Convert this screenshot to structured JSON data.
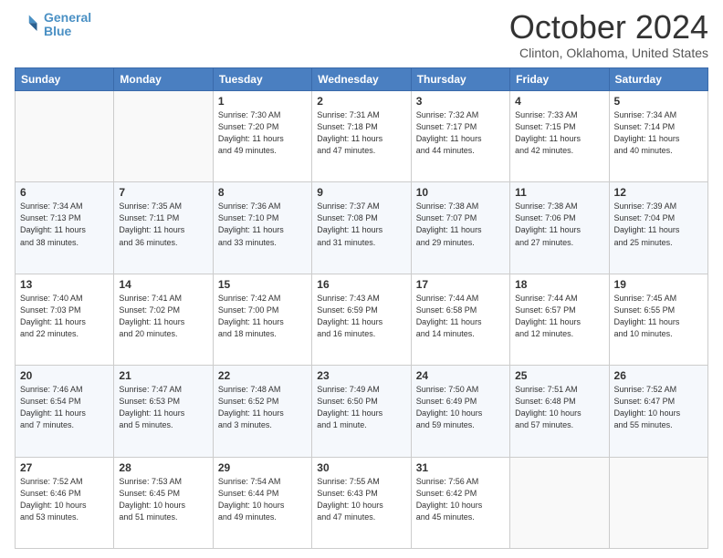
{
  "header": {
    "logo_line1": "General",
    "logo_line2": "Blue",
    "month": "October 2024",
    "location": "Clinton, Oklahoma, United States"
  },
  "weekdays": [
    "Sunday",
    "Monday",
    "Tuesday",
    "Wednesday",
    "Thursday",
    "Friday",
    "Saturday"
  ],
  "rows": [
    [
      {
        "day": "",
        "info": ""
      },
      {
        "day": "",
        "info": ""
      },
      {
        "day": "1",
        "info": "Sunrise: 7:30 AM\nSunset: 7:20 PM\nDaylight: 11 hours\nand 49 minutes."
      },
      {
        "day": "2",
        "info": "Sunrise: 7:31 AM\nSunset: 7:18 PM\nDaylight: 11 hours\nand 47 minutes."
      },
      {
        "day": "3",
        "info": "Sunrise: 7:32 AM\nSunset: 7:17 PM\nDaylight: 11 hours\nand 44 minutes."
      },
      {
        "day": "4",
        "info": "Sunrise: 7:33 AM\nSunset: 7:15 PM\nDaylight: 11 hours\nand 42 minutes."
      },
      {
        "day": "5",
        "info": "Sunrise: 7:34 AM\nSunset: 7:14 PM\nDaylight: 11 hours\nand 40 minutes."
      }
    ],
    [
      {
        "day": "6",
        "info": "Sunrise: 7:34 AM\nSunset: 7:13 PM\nDaylight: 11 hours\nand 38 minutes."
      },
      {
        "day": "7",
        "info": "Sunrise: 7:35 AM\nSunset: 7:11 PM\nDaylight: 11 hours\nand 36 minutes."
      },
      {
        "day": "8",
        "info": "Sunrise: 7:36 AM\nSunset: 7:10 PM\nDaylight: 11 hours\nand 33 minutes."
      },
      {
        "day": "9",
        "info": "Sunrise: 7:37 AM\nSunset: 7:08 PM\nDaylight: 11 hours\nand 31 minutes."
      },
      {
        "day": "10",
        "info": "Sunrise: 7:38 AM\nSunset: 7:07 PM\nDaylight: 11 hours\nand 29 minutes."
      },
      {
        "day": "11",
        "info": "Sunrise: 7:38 AM\nSunset: 7:06 PM\nDaylight: 11 hours\nand 27 minutes."
      },
      {
        "day": "12",
        "info": "Sunrise: 7:39 AM\nSunset: 7:04 PM\nDaylight: 11 hours\nand 25 minutes."
      }
    ],
    [
      {
        "day": "13",
        "info": "Sunrise: 7:40 AM\nSunset: 7:03 PM\nDaylight: 11 hours\nand 22 minutes."
      },
      {
        "day": "14",
        "info": "Sunrise: 7:41 AM\nSunset: 7:02 PM\nDaylight: 11 hours\nand 20 minutes."
      },
      {
        "day": "15",
        "info": "Sunrise: 7:42 AM\nSunset: 7:00 PM\nDaylight: 11 hours\nand 18 minutes."
      },
      {
        "day": "16",
        "info": "Sunrise: 7:43 AM\nSunset: 6:59 PM\nDaylight: 11 hours\nand 16 minutes."
      },
      {
        "day": "17",
        "info": "Sunrise: 7:44 AM\nSunset: 6:58 PM\nDaylight: 11 hours\nand 14 minutes."
      },
      {
        "day": "18",
        "info": "Sunrise: 7:44 AM\nSunset: 6:57 PM\nDaylight: 11 hours\nand 12 minutes."
      },
      {
        "day": "19",
        "info": "Sunrise: 7:45 AM\nSunset: 6:55 PM\nDaylight: 11 hours\nand 10 minutes."
      }
    ],
    [
      {
        "day": "20",
        "info": "Sunrise: 7:46 AM\nSunset: 6:54 PM\nDaylight: 11 hours\nand 7 minutes."
      },
      {
        "day": "21",
        "info": "Sunrise: 7:47 AM\nSunset: 6:53 PM\nDaylight: 11 hours\nand 5 minutes."
      },
      {
        "day": "22",
        "info": "Sunrise: 7:48 AM\nSunset: 6:52 PM\nDaylight: 11 hours\nand 3 minutes."
      },
      {
        "day": "23",
        "info": "Sunrise: 7:49 AM\nSunset: 6:50 PM\nDaylight: 11 hours\nand 1 minute."
      },
      {
        "day": "24",
        "info": "Sunrise: 7:50 AM\nSunset: 6:49 PM\nDaylight: 10 hours\nand 59 minutes."
      },
      {
        "day": "25",
        "info": "Sunrise: 7:51 AM\nSunset: 6:48 PM\nDaylight: 10 hours\nand 57 minutes."
      },
      {
        "day": "26",
        "info": "Sunrise: 7:52 AM\nSunset: 6:47 PM\nDaylight: 10 hours\nand 55 minutes."
      }
    ],
    [
      {
        "day": "27",
        "info": "Sunrise: 7:52 AM\nSunset: 6:46 PM\nDaylight: 10 hours\nand 53 minutes."
      },
      {
        "day": "28",
        "info": "Sunrise: 7:53 AM\nSunset: 6:45 PM\nDaylight: 10 hours\nand 51 minutes."
      },
      {
        "day": "29",
        "info": "Sunrise: 7:54 AM\nSunset: 6:44 PM\nDaylight: 10 hours\nand 49 minutes."
      },
      {
        "day": "30",
        "info": "Sunrise: 7:55 AM\nSunset: 6:43 PM\nDaylight: 10 hours\nand 47 minutes."
      },
      {
        "day": "31",
        "info": "Sunrise: 7:56 AM\nSunset: 6:42 PM\nDaylight: 10 hours\nand 45 minutes."
      },
      {
        "day": "",
        "info": ""
      },
      {
        "day": "",
        "info": ""
      }
    ]
  ]
}
